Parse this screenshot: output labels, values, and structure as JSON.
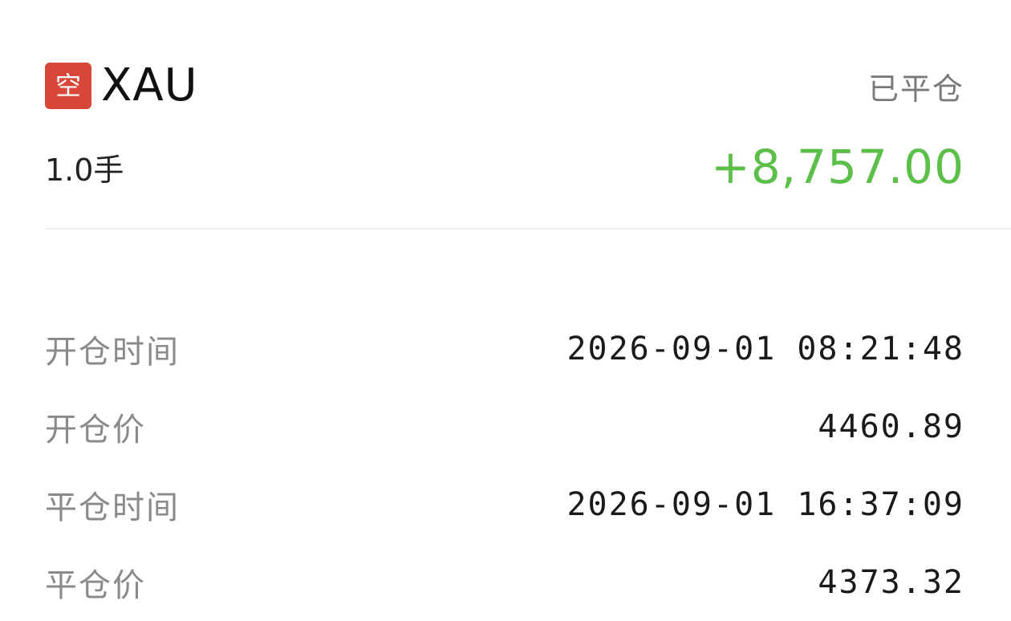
{
  "position": {
    "direction_badge": "空",
    "symbol": "XAU",
    "status": "已平仓",
    "lots": "1.0手",
    "pnl": "+8,757.00",
    "pnl_color": "#5bbf4a",
    "badge_color": "#d9473a"
  },
  "details": [
    {
      "label": "开仓时间",
      "value": "2026-09-01 08:21:48"
    },
    {
      "label": "开仓价",
      "value": "4460.89"
    },
    {
      "label": "平仓时间",
      "value": "2026-09-01 16:37:09"
    },
    {
      "label": "平仓价",
      "value": "4373.32"
    }
  ]
}
